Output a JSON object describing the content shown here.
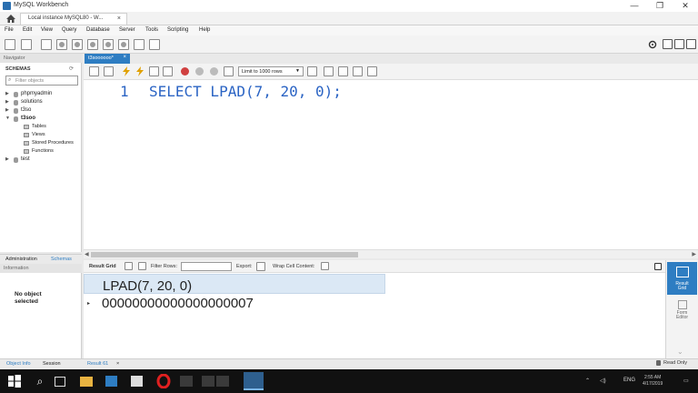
{
  "window": {
    "title": "MySQL Workbench",
    "controls": {
      "minimize": "—",
      "maximize": "❐",
      "close": "✕"
    }
  },
  "connection_tab": {
    "label": "Local instance MySQL80 - W...",
    "close": "×"
  },
  "menu": [
    "File",
    "Edit",
    "View",
    "Query",
    "Database",
    "Server",
    "Tools",
    "Scripting",
    "Help"
  ],
  "navigator": {
    "header": "Navigator",
    "schemas_label": "SCHEMAS",
    "filter_placeholder": "Filter objects",
    "schemas": [
      {
        "name": "phpmyadmin",
        "expanded": false,
        "bold": false
      },
      {
        "name": "solutions",
        "expanded": false,
        "bold": false
      },
      {
        "name": "t3so",
        "expanded": false,
        "bold": false
      },
      {
        "name": "t3soo",
        "expanded": true,
        "bold": true
      },
      {
        "name": "test",
        "expanded": false,
        "bold": false
      }
    ],
    "t3soo_children": [
      "Tables",
      "Views",
      "Stored Procedures",
      "Functions"
    ],
    "tabs": [
      "Administration",
      "Schemas"
    ],
    "active_tab": "Schemas"
  },
  "information": {
    "header": "Information",
    "no_object_line1": "No object",
    "no_object_line2": "selected"
  },
  "bottom_tabs": [
    "Object Info",
    "Session"
  ],
  "query_tab": {
    "label": "t3soooooo*",
    "close": "×"
  },
  "editor_toolbar": {
    "limit_label": "Limit to 1000 rows"
  },
  "editor": {
    "line_number": "1",
    "sql": "SELECT LPAD(7, 20, 0);"
  },
  "result_toolbar": {
    "result_grid": "Result Grid",
    "filter_rows": "Filter Rows:",
    "export": "Export:",
    "wrap_cell": "Wrap Cell Content:"
  },
  "result": {
    "column_header": "LPAD(7, 20, 0)",
    "rows": [
      "00000000000000000007"
    ]
  },
  "result_tabs": [
    {
      "label": "Result 61",
      "close": "×"
    }
  ],
  "right_panel": {
    "result_grid_line1": "Result",
    "result_grid_line2": "Grid",
    "form_editor_line1": "Form",
    "form_editor_line2": "Editor"
  },
  "status": {
    "read_only": "Read Only"
  },
  "taskbar": {
    "language": "ENG",
    "time": "2:55 AM",
    "date": "4/17/2019"
  },
  "colors": {
    "accent": "#2e7dc2",
    "sql_text": "#2b64c4",
    "header_row": "#dbe8f5",
    "taskbar": "#111111"
  }
}
